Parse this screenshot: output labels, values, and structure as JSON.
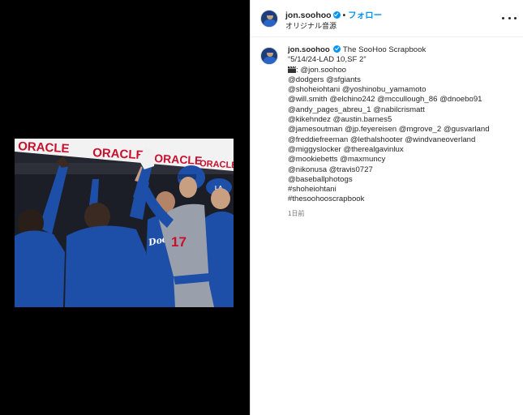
{
  "post": {
    "username": "jon.soohoo",
    "follow_label": "フォロー",
    "audio_label": "オリジナル音源",
    "caption": {
      "account_title": "The SooHoo Scrapbook",
      "lines": [
        "“5/14/24-LAD 10,SF 2”",
        ": @jon.soohoo",
        "@dodgers @sfgiants",
        "@shoheiohtani @yoshinobu_yamamoto",
        "@will.smith @elchino242 @mccullough_86 @dnoebo91",
        "@andy_pages_abreu_1 @nabilcrismatt",
        "@kikehndez @austin.barnes5",
        "@jamesoutman @jp.feyereisen @mgrove_2 @gusvarland",
        "@freddiefreeman @lethalshooter @windvaneoverland",
        "@miggyslocker @therealgavinlux",
        "@mookiebetts @maxmuncy",
        "@nikonusa @travis0727",
        "@baseballphotogs",
        "#shoheiohtani",
        "#thesoohooscrapbook"
      ],
      "time": "1日前"
    }
  },
  "photo": {
    "banner_text_1": "ORACLE",
    "banner_text_2": "ORACLE",
    "banner_text_3": "ORACLE",
    "banner_text_4": "ORACLE",
    "jersey_word": "Dodgers",
    "jersey_number": "17",
    "cap_letters": "LA"
  },
  "colors": {
    "link": "#0095f6",
    "verified": "#0095f6",
    "dodger_blue": "#1e4fa8",
    "banner_red": "#c8102e"
  },
  "icons": [
    "verified-badge-icon",
    "more-options-icon",
    "clapper-icon"
  ]
}
